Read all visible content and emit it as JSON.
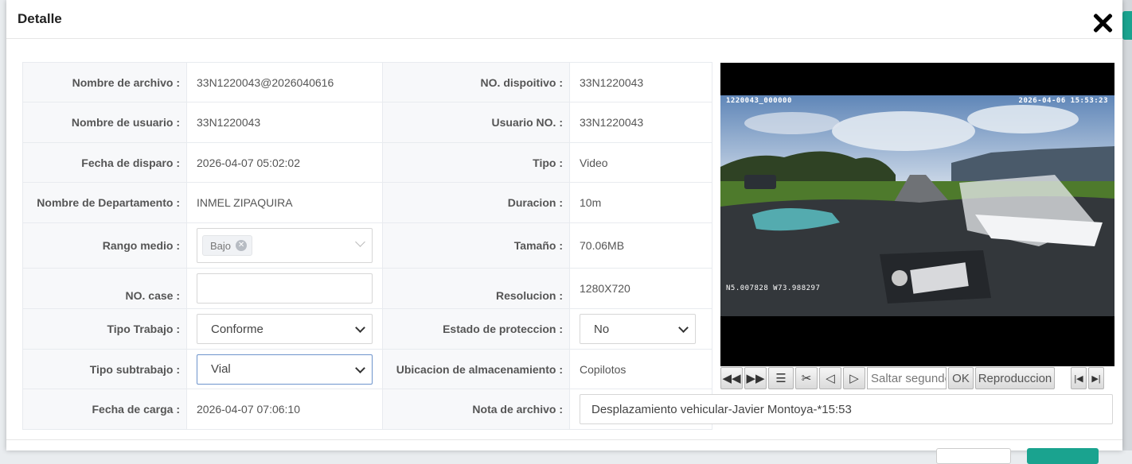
{
  "modal": {
    "title": "Detalle"
  },
  "fields": {
    "file_name": {
      "label": "Nombre de archivo",
      "value": "33N1220043@2026040616"
    },
    "device_no": {
      "label": "NO. dispoitivo",
      "value": "33N1220043"
    },
    "user_name": {
      "label": "Nombre de usuario",
      "value": "33N1220043"
    },
    "user_no": {
      "label": "Usuario NO.",
      "value": "33N1220043"
    },
    "trigger_date": {
      "label": "Fecha de disparo",
      "value": "2026-04-07 05:02:02"
    },
    "type": {
      "label": "Tipo",
      "value": "Video"
    },
    "department": {
      "label": "Nombre de Departamento",
      "value": "INMEL ZIPAQUIRA"
    },
    "duration": {
      "label": "Duracion",
      "value": "10m"
    },
    "mid_range": {
      "label": "Rango medio",
      "tag": "Bajo"
    },
    "size": {
      "label": "Tamaño",
      "value": "70.06MB"
    },
    "case_no": {
      "label": "NO. case",
      "value": ""
    },
    "resolution": {
      "label": "Resolucion",
      "value": "1280X720"
    },
    "work_type": {
      "label": "Tipo Trabajo",
      "value": "Conforme"
    },
    "protection": {
      "label": "Estado de proteccion",
      "value": "No"
    },
    "subwork_type": {
      "label": "Tipo subtrabajo",
      "value": "Vial"
    },
    "storage": {
      "label": "Ubicacion de almacenamiento",
      "value": "Copilotos"
    },
    "upload_date": {
      "label": "Fecha de carga",
      "value": "2026-04-07 07:06:10"
    },
    "file_note": {
      "label": "Nota de archivo",
      "value": "Desplazamiento vehicular-Javier Montoya-*15:53"
    }
  },
  "video": {
    "osd_id": "1220043_000000",
    "osd_time": "2026-04-06  15:53:23",
    "osd_gps": "N5.007828  W73.988297"
  },
  "player": {
    "seek_placeholder": "Saltar segundos",
    "ok_label": "OK",
    "play_label": "Reproduccion"
  },
  "icons": [
    "close-icon",
    "rewind-icon",
    "fast-forward-icon",
    "indent-icon",
    "scissors-icon",
    "prev-frame-icon",
    "next-frame-icon",
    "skip-start-icon",
    "skip-end-icon"
  ],
  "colors": {
    "accent": "#1aa38f",
    "select_focus": "#6e94cc"
  }
}
